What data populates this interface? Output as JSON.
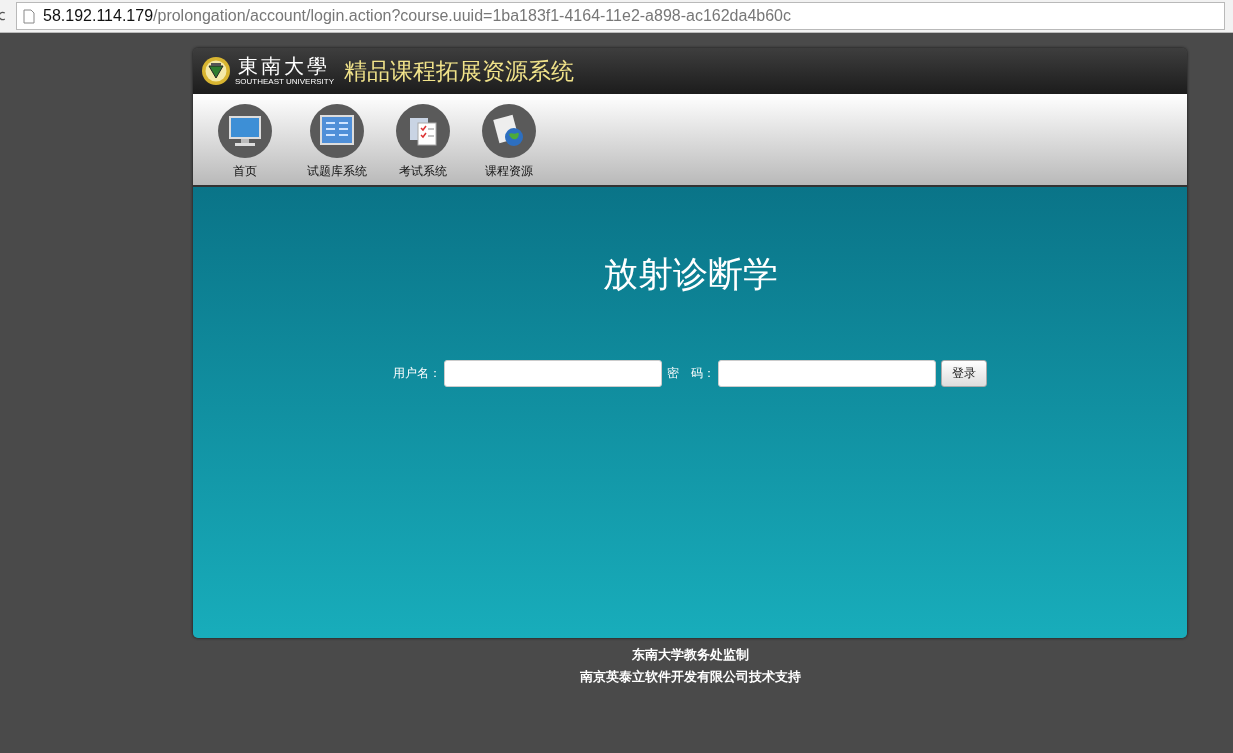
{
  "address_bar": {
    "host": "58.192.114.179",
    "path": "/prolongation/account/login.action?course.uuid=1ba183f1-4164-11e2-a898-ac162da4b60c"
  },
  "header": {
    "logo_text": "東南大學",
    "logo_subtext": "SOUTHEAST UNIVERSITY",
    "title": "精品课程拓展资源系统"
  },
  "nav": [
    {
      "kind": "monitor",
      "label": "首页"
    },
    {
      "kind": "board",
      "label": "试题库系统"
    },
    {
      "kind": "checklist",
      "label": "考试系统"
    },
    {
      "kind": "globe",
      "label": "课程资源"
    }
  ],
  "course_title": "放射诊断学",
  "login": {
    "username_label": "用户名：",
    "password_label": "密　码：",
    "button": "登录"
  },
  "footer": [
    "东南大学教务处监制",
    "南京英泰立软件开发有限公司技术支持"
  ]
}
